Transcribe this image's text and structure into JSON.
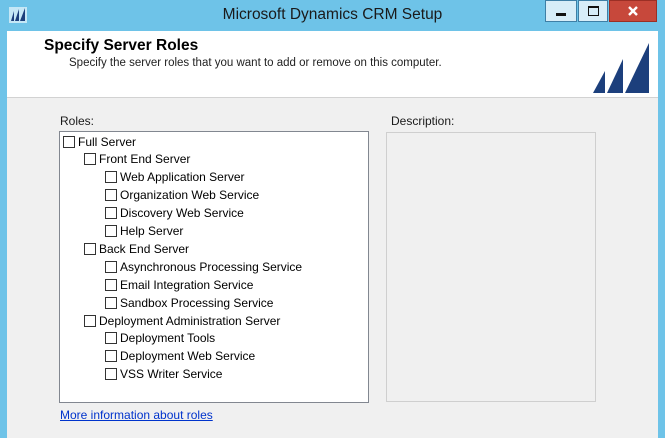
{
  "window": {
    "title": "Microsoft Dynamics CRM Setup",
    "buttons": {
      "minimize": "–",
      "maximize": "□",
      "close": "✕"
    }
  },
  "header": {
    "title": "Specify Server Roles",
    "subtitle": "Specify the server roles that you want to add or remove on this computer.",
    "logo_icon": "dynamics-logo-icon"
  },
  "content": {
    "roles_label": "Roles:",
    "description_label": "Description:",
    "description_text": "",
    "roles": [
      {
        "label": "Full Server",
        "level": 0,
        "checked": false
      },
      {
        "label": "Front End Server",
        "level": 1,
        "checked": false
      },
      {
        "label": "Web Application Server",
        "level": 2,
        "checked": false
      },
      {
        "label": "Organization Web Service",
        "level": 2,
        "checked": false
      },
      {
        "label": "Discovery Web Service",
        "level": 2,
        "checked": false
      },
      {
        "label": "Help Server",
        "level": 2,
        "checked": false
      },
      {
        "label": "Back End Server",
        "level": 1,
        "checked": false
      },
      {
        "label": "Asynchronous Processing Service",
        "level": 2,
        "checked": false
      },
      {
        "label": "Email Integration Service",
        "level": 2,
        "checked": false
      },
      {
        "label": "Sandbox Processing Service",
        "level": 2,
        "checked": false
      },
      {
        "label": "Deployment Administration Server",
        "level": 1,
        "checked": false
      },
      {
        "label": "Deployment Tools",
        "level": 2,
        "checked": false
      },
      {
        "label": "Deployment Web Service",
        "level": 2,
        "checked": false
      },
      {
        "label": "VSS Writer Service",
        "level": 2,
        "checked": false
      }
    ],
    "more_info_link": "More information about roles"
  },
  "colors": {
    "titlebar": "#6ec3e8",
    "link": "#0033cc",
    "close_button": "#c7483b",
    "logo": "#1c3f7c"
  }
}
